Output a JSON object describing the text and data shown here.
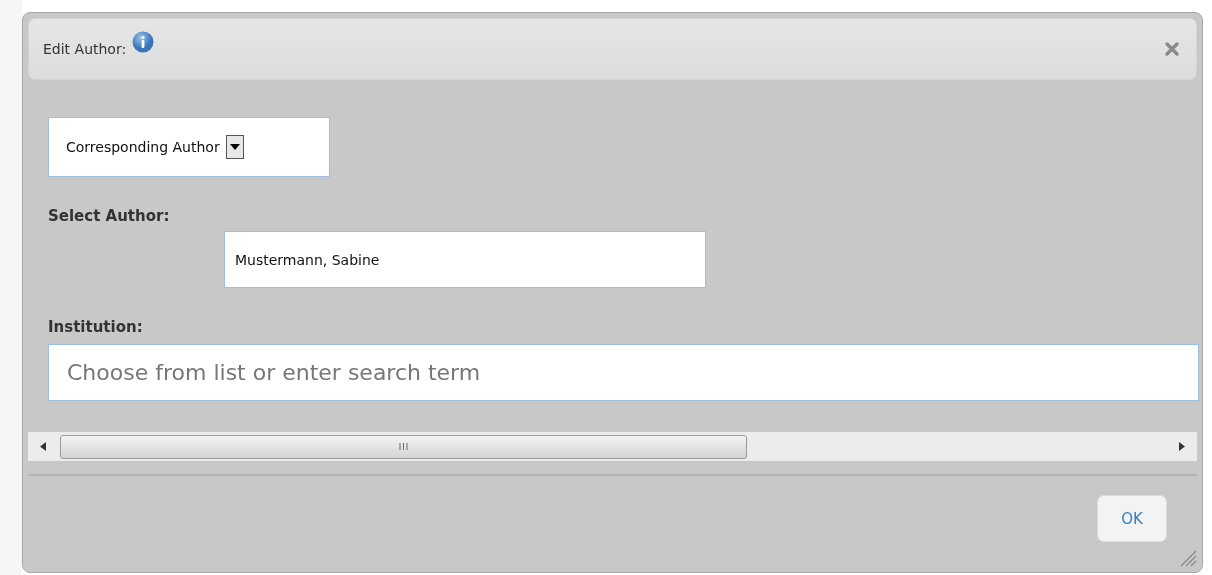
{
  "dialog": {
    "title": "Edit Author:",
    "role_select": {
      "value": "Corresponding Author"
    },
    "select_author": {
      "label": "Select Author:",
      "value": "Mustermann, Sabine"
    },
    "institution": {
      "label": "Institution:",
      "placeholder": "Choose from list or enter search term"
    },
    "buttons": [
      "OK"
    ]
  }
}
